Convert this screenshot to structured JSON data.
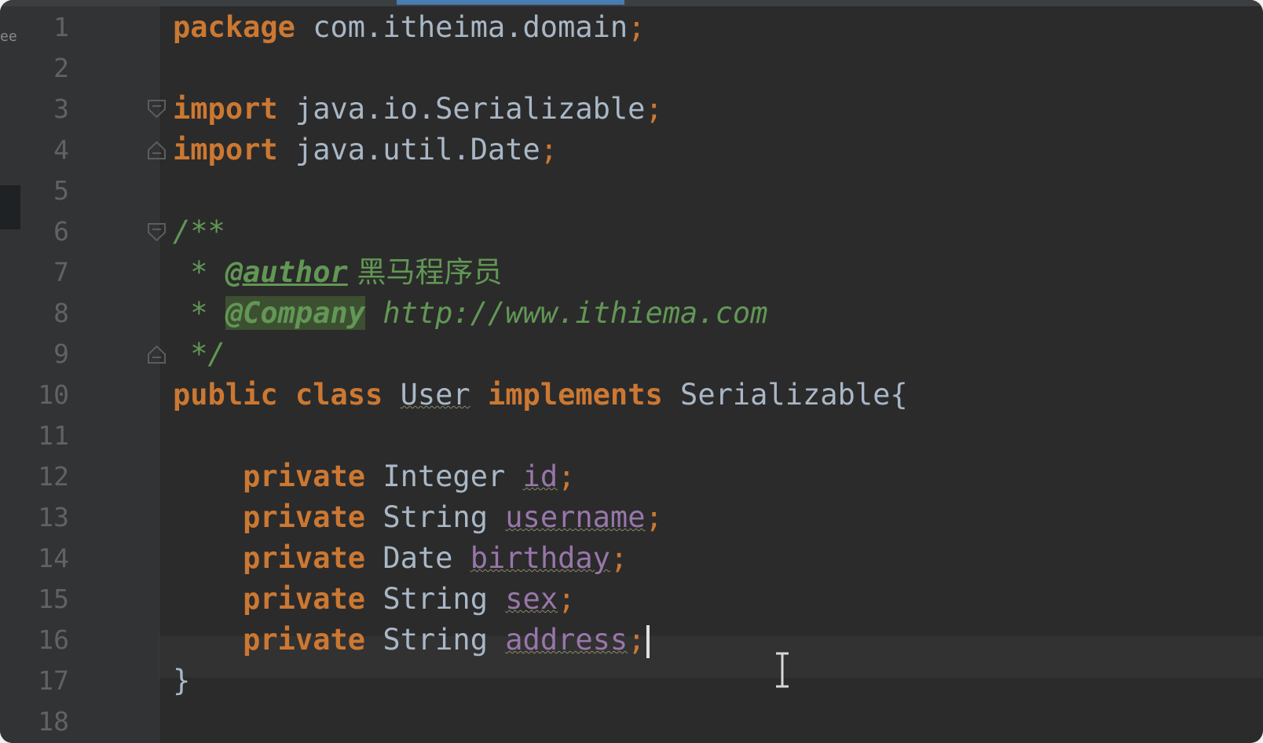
{
  "editor": {
    "language": "java",
    "left_strip_text": "ee",
    "caret_line": 16,
    "line_numbers": [
      "1",
      "2",
      "3",
      "4",
      "5",
      "6",
      "7",
      "8",
      "9",
      "10",
      "11",
      "12",
      "13",
      "14",
      "15",
      "16",
      "17",
      "18"
    ],
    "lines": {
      "l1": {
        "kw": "package",
        "rest": " com.itheima.domain",
        "semi": ";"
      },
      "l3": {
        "kw": "import",
        "rest": " java.io.Serializable",
        "semi": ";"
      },
      "l4": {
        "kw": "import",
        "rest": " java.util.Date",
        "semi": ";"
      },
      "l6": {
        "open": "/**"
      },
      "l7": {
        "star": " * ",
        "tag": "@author",
        "text": " 黑马程序员"
      },
      "l8": {
        "star": " * ",
        "tag": "@Company",
        "text": " http://www.ithiema.com"
      },
      "l9": {
        "close": " */"
      },
      "l10": {
        "kw1": "public",
        "kw2": "class",
        "name": "User",
        "kw3": "implements",
        "iface": "Serializable",
        "brace": "{"
      },
      "l12": {
        "indent": "    ",
        "kw": "private",
        "type": "Integer",
        "field": "id",
        "semi": ";"
      },
      "l13": {
        "indent": "    ",
        "kw": "private",
        "type": "String",
        "field": "username",
        "semi": ";"
      },
      "l14": {
        "indent": "    ",
        "kw": "private",
        "type": "Date",
        "field": "birthday",
        "semi": ";"
      },
      "l15": {
        "indent": "    ",
        "kw": "private",
        "type": "String",
        "field": "sex",
        "semi": ";"
      },
      "l16": {
        "indent": "    ",
        "kw": "private",
        "type": "String",
        "field": "address",
        "semi": ";"
      },
      "l17": {
        "brace": "}"
      }
    }
  },
  "colors": {
    "background": "#2b2b2b",
    "keyword": "#cc7832",
    "comment": "#629755",
    "field": "#9876aa",
    "plain": "#a9b7c6",
    "line_number": "#606366"
  }
}
